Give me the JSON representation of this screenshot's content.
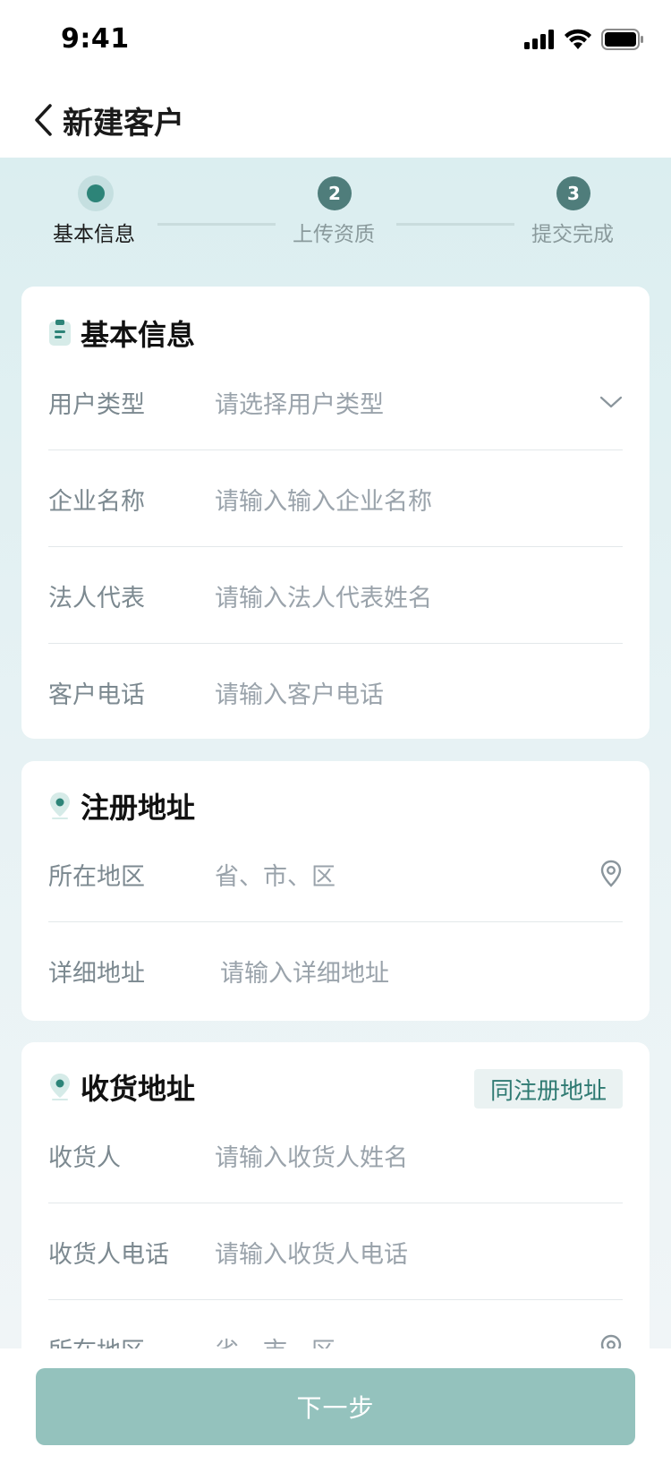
{
  "status_bar": {
    "time": "9:41"
  },
  "nav": {
    "title": "新建客户"
  },
  "steps": [
    {
      "label": "基本信息",
      "number": "",
      "active": true
    },
    {
      "label": "上传资质",
      "number": "2",
      "active": false
    },
    {
      "label": "提交完成",
      "number": "3",
      "active": false
    }
  ],
  "basic_info": {
    "title": "基本信息",
    "icon": "clipboard-icon",
    "fields": [
      {
        "label": "用户类型",
        "placeholder": "请选择用户类型",
        "icon": "chevron-down-icon"
      },
      {
        "label": "企业名称",
        "placeholder": "请输入输入企业名称"
      },
      {
        "label": "法人代表",
        "placeholder": "请输入法人代表姓名"
      },
      {
        "label": "客户电话",
        "placeholder": "请输入客户电话"
      }
    ]
  },
  "reg_address": {
    "title": "注册地址",
    "icon": "location-pin-icon",
    "fields": [
      {
        "label": "所在地区",
        "placeholder": "省、市、区",
        "icon": "location-icon"
      },
      {
        "label": "详细地址",
        "placeholder": "请输入详细地址"
      }
    ]
  },
  "ship_address": {
    "title": "收货地址",
    "icon": "location-pin-icon",
    "same_label": "同注册地址",
    "fields": [
      {
        "label": "收货人",
        "placeholder": "请输入收货人姓名"
      },
      {
        "label": "收货人电话",
        "placeholder": "请输入收货人电话"
      },
      {
        "label": "所在地区",
        "placeholder": "省、市、区",
        "icon": "location-icon"
      }
    ]
  },
  "footer": {
    "next_label": "下一步"
  },
  "colors": {
    "accent": "#2d8478",
    "step_inactive": "#4f7d7b",
    "button": "#94c2bd",
    "page_bg": "#dbeef0"
  }
}
